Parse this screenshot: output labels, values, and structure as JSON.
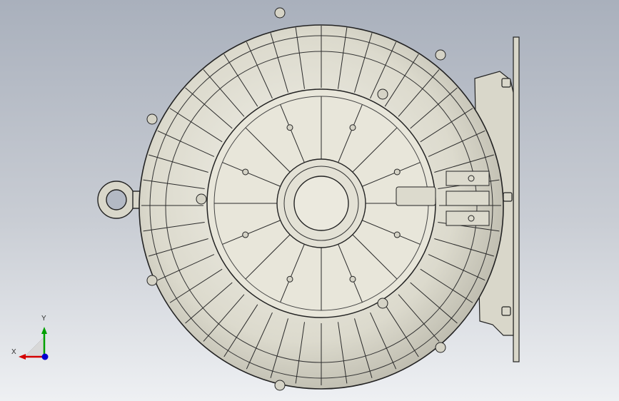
{
  "axes": {
    "x_label": "X",
    "y_label": "Y",
    "x_color": "#d40000",
    "y_color": "#00a000",
    "z_color": "#0000d0"
  },
  "model": {
    "body_color": "#e6e4d8",
    "edge_color": "#202020",
    "background_top": "#a9b0bc",
    "background_bottom": "#eef0f3"
  }
}
